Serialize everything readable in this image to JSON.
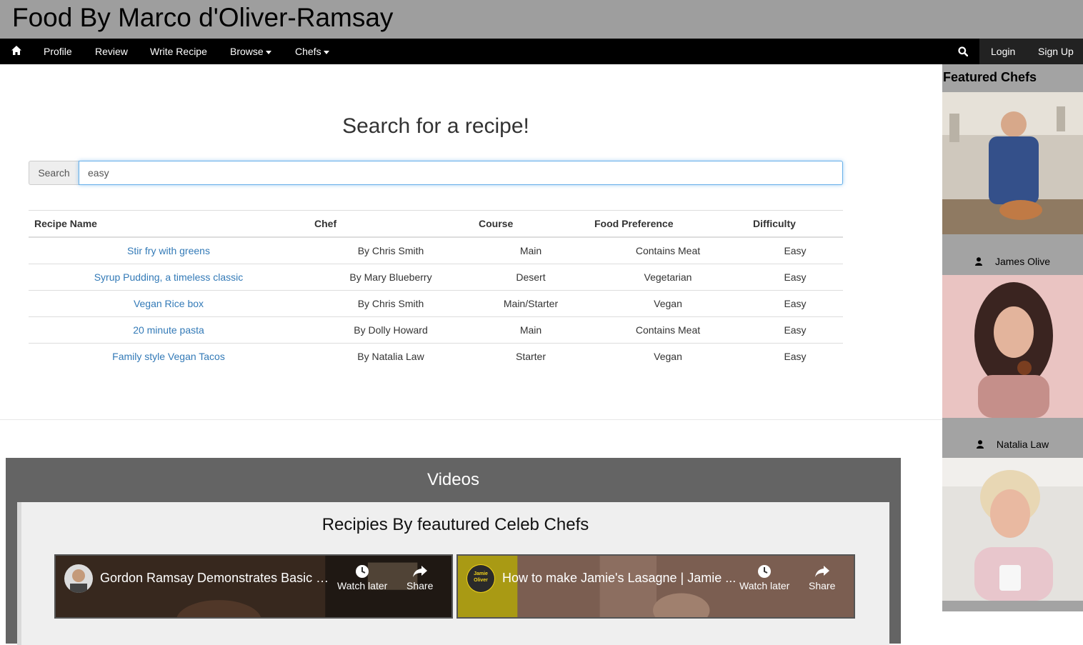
{
  "site": {
    "title": "Food By Marco d'Oliver-Ramsay"
  },
  "nav": {
    "home_icon": "home-icon",
    "items": [
      "Profile",
      "Review",
      "Write Recipe",
      "Browse",
      "Chefs"
    ],
    "search_icon": "search-icon",
    "login": "Login",
    "signup": "Sign Up"
  },
  "search": {
    "heading": "Search for a recipe!",
    "addon_label": "Search",
    "value": "easy"
  },
  "table": {
    "headers": [
      "Recipe Name",
      "Chef",
      "Course",
      "Food Preference",
      "Difficulty"
    ],
    "rows": [
      [
        "Stir fry with greens",
        "By Chris Smith",
        "Main",
        "Contains Meat",
        "Easy"
      ],
      [
        "Syrup Pudding, a timeless classic",
        "By Mary Blueberry",
        "Desert",
        "Vegetarian",
        "Easy"
      ],
      [
        "Vegan Rice box",
        "By Chris Smith",
        "Main/Starter",
        "Vegan",
        "Easy"
      ],
      [
        "20 minute pasta",
        "By Dolly Howard",
        "Main",
        "Contains Meat",
        "Easy"
      ],
      [
        "Family style Vegan Tacos",
        "By Natalia Law",
        "Starter",
        "Vegan",
        "Easy"
      ]
    ]
  },
  "videos": {
    "heading": "Videos",
    "subheading": "Recipies By feautured Celeb Chefs",
    "items": [
      {
        "title": "Gordon Ramsay Demonstrates Basic C...",
        "watch_later": "Watch later",
        "share": "Share"
      },
      {
        "title": "How to make Jamie's Lasagne | Jamie ...",
        "watch_later": "Watch later",
        "share": "Share",
        "channel_badge": "Jamie Oliver"
      }
    ]
  },
  "sidebar": {
    "heading": "Featured Chefs",
    "chefs": [
      {
        "name": "James Olive",
        "icon": "user-icon"
      },
      {
        "name": "Natalia Law",
        "icon": "user-icon"
      }
    ]
  },
  "colors": {
    "banner_bg": "#9e9e9e",
    "nav_bg": "#000000",
    "link": "#337ab7",
    "videos_bg": "#646464",
    "sidebar_bg": "#a3a3a3"
  }
}
